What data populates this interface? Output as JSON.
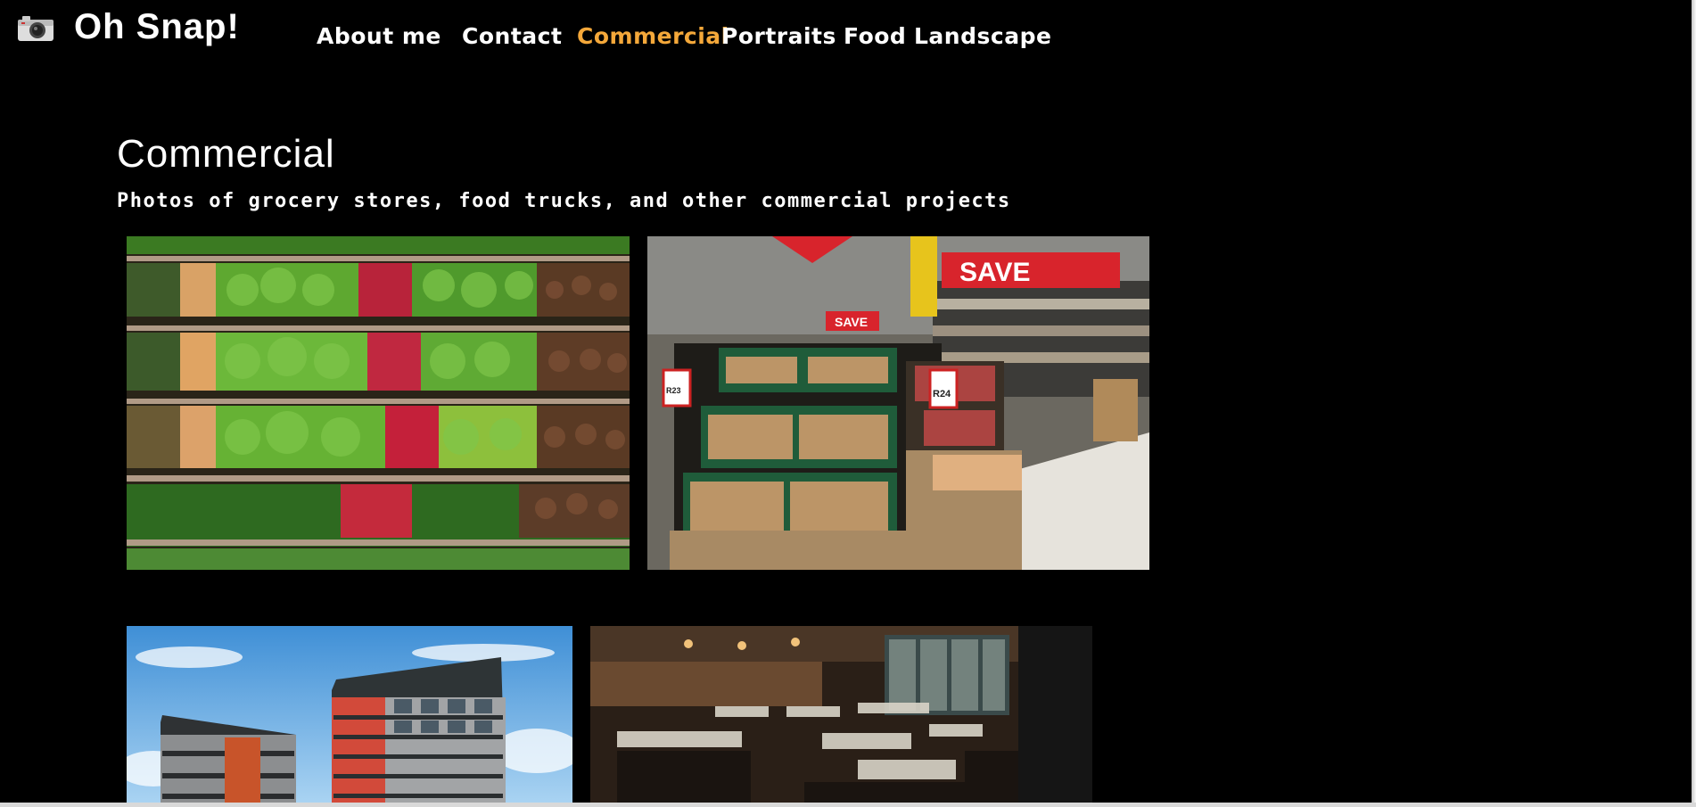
{
  "brand": {
    "title": "Oh Snap!",
    "icon": "camera-icon"
  },
  "nav": {
    "items": [
      {
        "label": "About me",
        "active": false
      },
      {
        "label": "Contact",
        "active": false
      },
      {
        "label": "Commercial",
        "active": true
      },
      {
        "label": "Portraits",
        "active": false
      },
      {
        "label": "Food",
        "active": false
      },
      {
        "label": "Landscape",
        "active": false
      }
    ]
  },
  "page": {
    "title": "Commercial",
    "subtitle": "Photos of grocery stores, food trucks, and other commercial projects"
  },
  "gallery": {
    "photos": [
      {
        "subject": "produce-shelves"
      },
      {
        "subject": "supermarket-aisle",
        "signs": [
          "SAVE",
          "SAVE",
          "SAVE",
          "R24",
          "R23"
        ]
      },
      {
        "subject": "apartment-building"
      },
      {
        "subject": "restaurant-interior"
      }
    ]
  },
  "colors": {
    "background": "#000000",
    "text": "#ffffff",
    "nav_active": "#f4a83a"
  }
}
